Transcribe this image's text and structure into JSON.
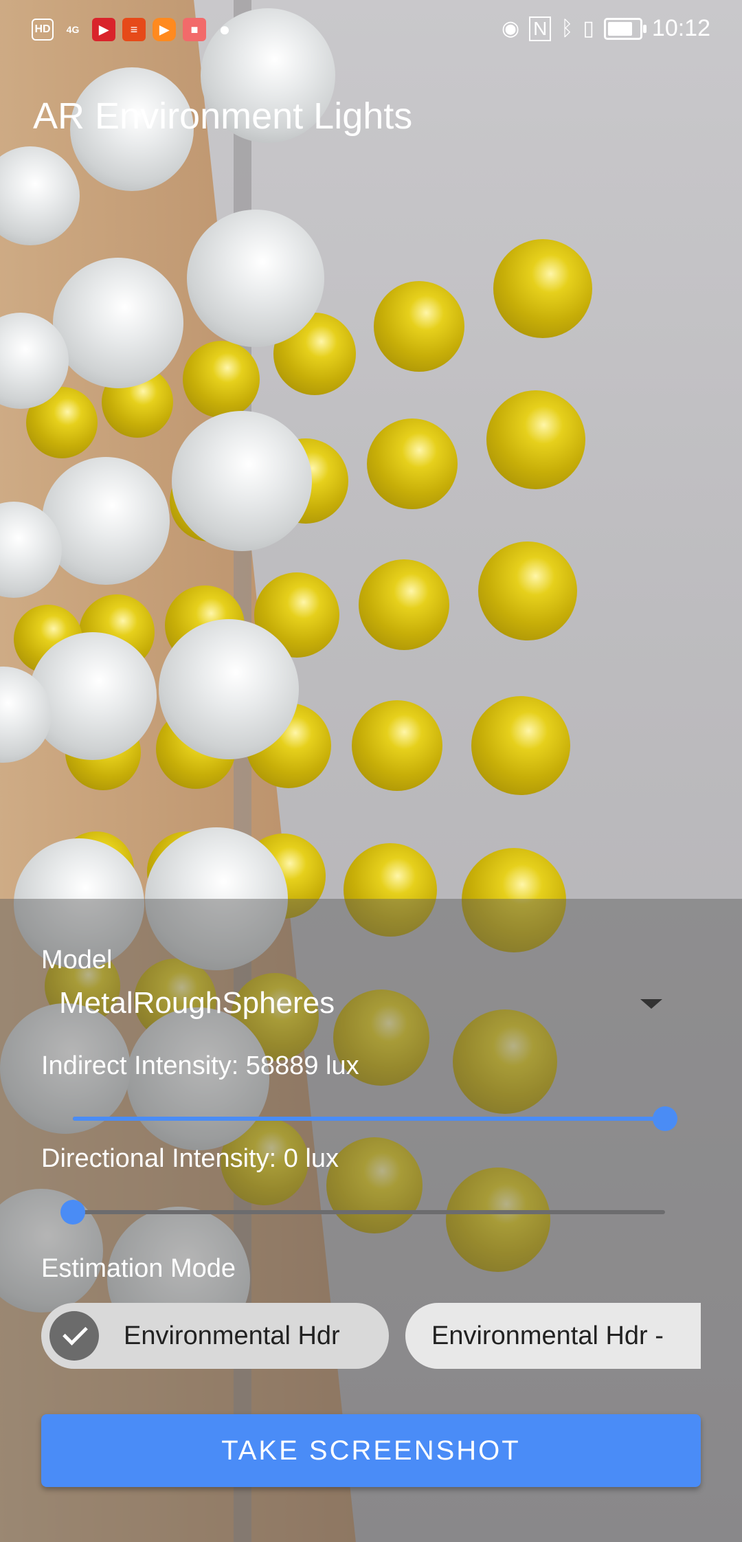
{
  "status_bar": {
    "left_icons": [
      "HD",
      "4G",
      "signal-icon",
      "video-app-icon",
      "news-app-icon",
      "player-app-icon",
      "store-app-icon",
      "wechat-icon"
    ],
    "right_icons": [
      "eye-icon",
      "nfc-icon",
      "bluetooth-icon",
      "vibrate-icon",
      "battery-icon"
    ],
    "time": "10:12"
  },
  "app": {
    "title": "AR Environment Lights"
  },
  "controls": {
    "model_label": "Model",
    "model_value": "MetalRoughSpheres",
    "indirect_label": "Indirect Intensity: 58889 lux",
    "indirect_level": 1.0,
    "directional_label": "Directional Intensity: 0 lux",
    "directional_level": 0.0,
    "estimation_label": "Estimation Mode",
    "chips": [
      {
        "label": "Environmental Hdr",
        "selected": true
      },
      {
        "label": "Environmental Hdr -",
        "selected": false
      }
    ],
    "screenshot_button": "TAKE SCREENSHOT"
  },
  "colors": {
    "accent": "#4a8cf5",
    "panel": "#5a5a5c"
  }
}
